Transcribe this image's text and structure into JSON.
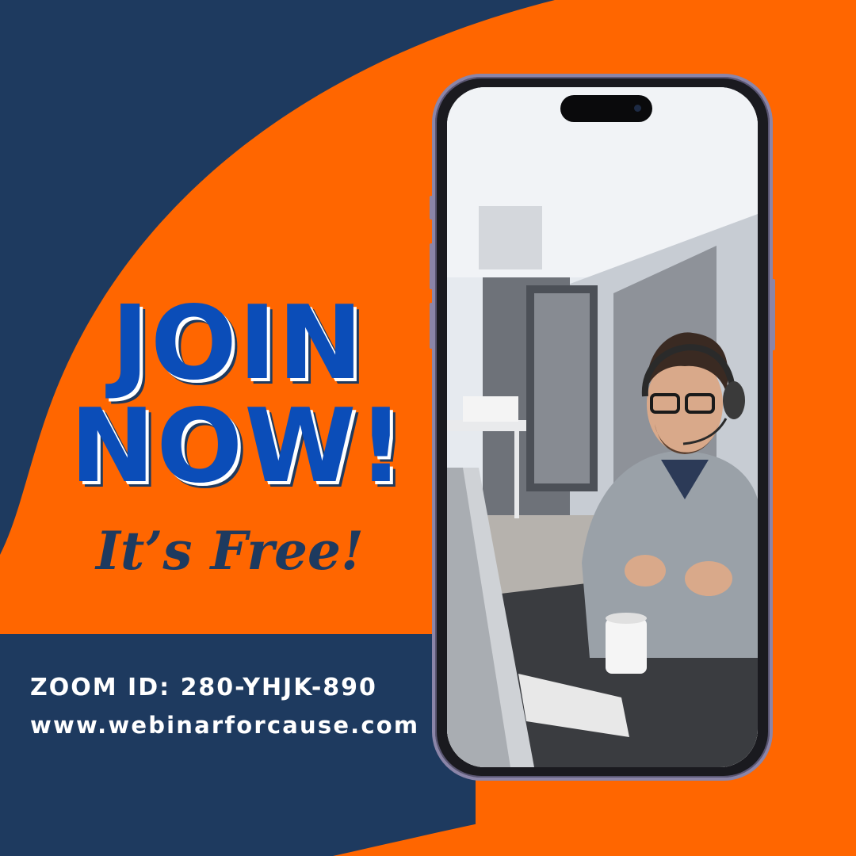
{
  "colors": {
    "orange": "#ff6600",
    "navy": "#1e3a5f",
    "blue": "#0b4db8",
    "white": "#ffffff",
    "phone_frame": "#8b85a8"
  },
  "headline": {
    "line1": "JOIN",
    "line2": "NOW!"
  },
  "subhead": "It’s Free!",
  "info": {
    "zoom": "ZOOM ID: 280-YHJK-890",
    "url": "www.webinarforcause.com"
  },
  "phone": {
    "photo_subject": "smiling man wearing headset at desk"
  }
}
